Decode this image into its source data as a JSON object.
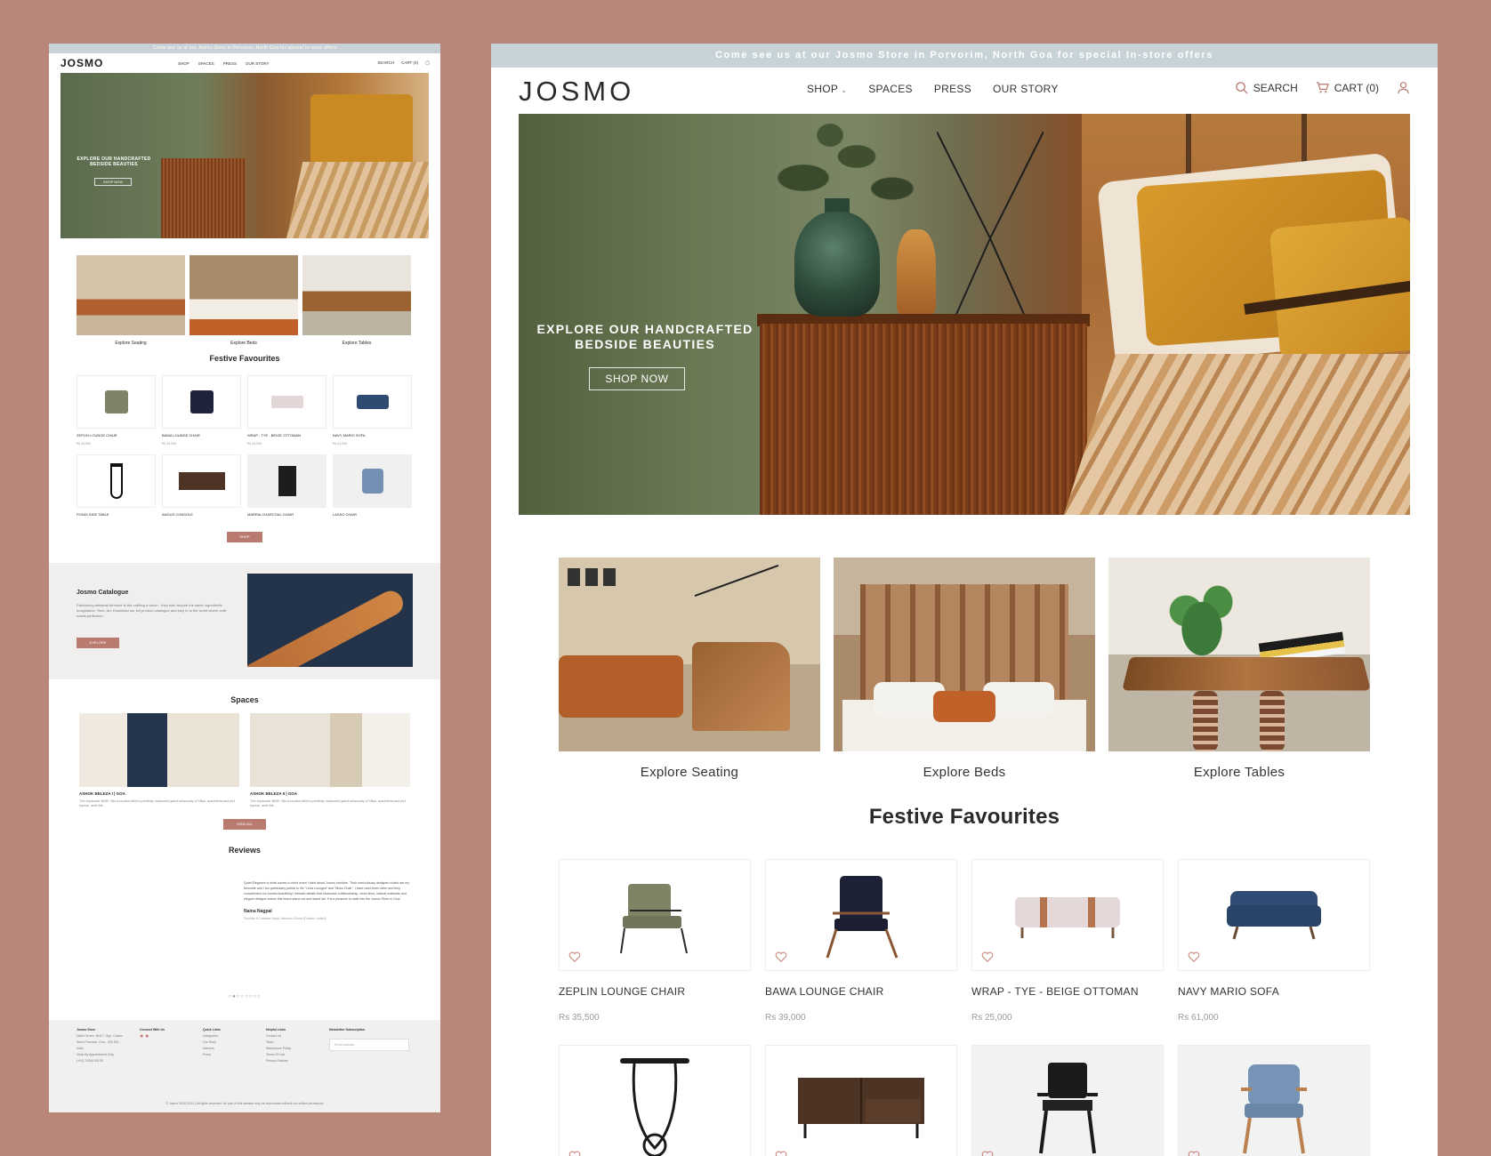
{
  "banner": "Come see us at our Josmo Store in Porvorim, North Goa for special In-store offers",
  "logo": "JOSMO",
  "nav": {
    "shop": "SHOP",
    "spaces": "SPACES",
    "press": "PRESS",
    "story": "OUR STORY"
  },
  "tools": {
    "search": "SEARCH",
    "cart": "CART (0)"
  },
  "hero": {
    "heading": "EXPLORE OUR HANDCRAFTED BEDSIDE BEAUTIES",
    "button": "SHOP NOW"
  },
  "categories": [
    {
      "label": "Explore Seating"
    },
    {
      "label": "Explore Beds"
    },
    {
      "label": "Explore Tables"
    }
  ],
  "festive_title": "Festive Favourites",
  "products": [
    {
      "name": "ZEPLIN LOUNGE CHAIR",
      "price": "Rs 35,500"
    },
    {
      "name": "BAWA LOUNGE CHAIR",
      "price": "Rs 39,000"
    },
    {
      "name": "WRAP - TYE - BEIGE OTTOMAN",
      "price": "Rs 25,000"
    },
    {
      "name": "NAVY MARIO SOFA",
      "price": "Rs 61,000"
    },
    {
      "name": "PONDI SIDE TABLE",
      "price": ""
    },
    {
      "name": "ANGUS CONSOLE",
      "price": ""
    },
    {
      "name": "MARRIA CHARCOAL CHAIR",
      "price": ""
    },
    {
      "name": "LASSO CHAIR",
      "price": ""
    }
  ],
  "mini": {
    "hero_heading": "EXPLORE OUR HANDCRAFTED BEDSIDE BEAUTIES",
    "hero_button": "SHOP NOW",
    "shop_button": "SHOP",
    "catalogue_title": "Josmo Catalogue",
    "catalogue_text": "Fashioning artisanal furniture is like crafting a vision - they both require the same ingredients: Imagination, Time, Art. Download our full product catalogue and step in to the world where craft meets perfection.",
    "explore_button": "EXPLORE",
    "spaces_title": "Spaces",
    "spaces": [
      {
        "name": "ASHOK BELEZA I | GOA",
        "text": "This expansive 4BHK Villa is located within a perfectly manicured gated community of Villas, apartments and plot layouts, amid the..."
      },
      {
        "name": "ASHOK BELEZA II | GOA",
        "text": "This expansive 3BHK Villa is located within a perfectly manicured gated community of Villas, apartments and plot layouts, amid the..."
      }
    ],
    "view_all": "VIEW ALL",
    "reviews_title": "Reviews",
    "review_text": "Quiet Elegance is what comes to mind when I think about Josmo furniture. Their meticulously designed chairs are my favourite and I am particularly partial to the \"Lima Lounges\" and \"Moss Chair\". I have used them often and they complement our homes beautifully! Intricate details that showcase craftsmanship, clean lines, natural materials and elegant designs makes this brand stand out and stand tall. It is a pleasure to walk into the Josmo Store in Goa!",
    "reviewer": "Naina Nagpal",
    "reviewer_role": "Founder & Creative Head, Mansion Goods (Private Limited)",
    "footer": {
      "store_h": "Josmo Store",
      "store_addr": "Delta Centre, NH17, Opp. Cosmo Store Porvorim, Goa - 403 501 - India",
      "store_visit": "Visits By Appointment Only",
      "store_phone": "(+91) 79208 50139",
      "connect_h": "Connect With Us",
      "quick_h": "Quick Links",
      "quick": [
        "Categories",
        "Our Story",
        "Interiors",
        "Press"
      ],
      "help_h": "Helpful Links",
      "help": [
        "Contact Us",
        "Team",
        "Warehouse Policy",
        "Terms Of Use",
        "Privacy Policies"
      ],
      "news_h": "Newsletter Subscription",
      "email_ph": "Email address",
      "copy": "© Josmo 2020-2021 | All rights reserved. No part of this website may be reproduced without our written permission"
    }
  },
  "colors": {
    "accent": "#b97a70",
    "banner": "#c7d3d7",
    "page_bg": "#b9877a"
  }
}
